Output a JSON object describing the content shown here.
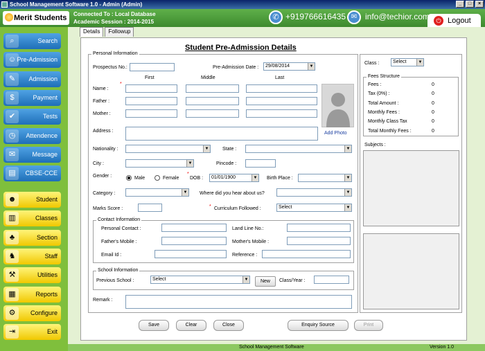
{
  "window": {
    "title": "School Management Software 1.0 -  Admin (Admin)"
  },
  "header": {
    "app_name": "Merit Students",
    "connection": "Connected To : Local Database",
    "session": "Academic Session : 2014-2015",
    "phone": "+919766616435",
    "email": "info@techior.com",
    "logout_label": "Logout"
  },
  "sidebar": {
    "blue_items": [
      {
        "label": "Search",
        "icon": "magnifier-icon"
      },
      {
        "label": "Pre-Admission",
        "icon": "person-icon"
      },
      {
        "label": "Admission",
        "icon": "pencil-icon"
      },
      {
        "label": "Payment",
        "icon": "cash-icon"
      },
      {
        "label": "Tests",
        "icon": "checklist-icon"
      },
      {
        "label": "Attendence",
        "icon": "clock-icon"
      },
      {
        "label": "Message",
        "icon": "envelope-icon"
      },
      {
        "label": "CBSE-CCE",
        "icon": "book-icon"
      }
    ],
    "yellow_items": [
      {
        "label": "Student",
        "icon": "students-icon"
      },
      {
        "label": "Classes",
        "icon": "document-icon"
      },
      {
        "label": "Section",
        "icon": "group-icon"
      },
      {
        "label": "Staff",
        "icon": "staff-icon"
      },
      {
        "label": "Utilities",
        "icon": "tools-icon"
      },
      {
        "label": "Reports",
        "icon": "report-icon"
      },
      {
        "label": "Configure",
        "icon": "gear-icon"
      },
      {
        "label": "Exit",
        "icon": "exit-icon"
      }
    ]
  },
  "tabs": [
    "Details",
    "Followup"
  ],
  "form": {
    "title": "Student Pre-Admission Details",
    "personal_legend": "Personal Information",
    "prospectus_label": "Prospectus No.:",
    "prospectus_value": "",
    "pre_date_label": "Pre-Admission Date :",
    "pre_date_value": "29/08/2014",
    "col_first": "First",
    "col_middle": "Middle",
    "col_last": "Last",
    "name_label": "Name :",
    "father_label": "Father :",
    "mother_label": "Mother :",
    "address_label": "Address :",
    "add_photo": "Add Photo",
    "nationality_label": "Nationality :",
    "state_label": "State :",
    "city_label": "City :",
    "pincode_label": "Pincode :",
    "gender_label": "Gender :",
    "male": "Male",
    "female": "Female",
    "dob_label": "DOB :",
    "dob_value": "01/01/1900",
    "birth_place_label": "Birth Place :",
    "category_label": "Category :",
    "hear_label": "Where did you hear about us?",
    "marks_label": "Marks Score :",
    "curriculum_label": "Curriculum Followed :",
    "curriculum_value": "Select",
    "contact_legend": "Contact Information",
    "personal_contact_label": "Personal Contact :",
    "landline_label": "Land Line No.:",
    "father_mobile_label": "Father's Mobile :",
    "mother_mobile_label": "Mother's Mobile :",
    "email_label": "Email Id :",
    "reference_label": "Reference :",
    "school_legend": "School Information",
    "previous_school_label": "Previous School :",
    "previous_school_value": "Select",
    "new_button": "New",
    "class_year_label": "Class/Year :",
    "remark_label": "Remark :"
  },
  "right_panel": {
    "class_label": "Class :",
    "class_value": "Select",
    "fees_legend": "Fees Structure",
    "fees_rows": [
      {
        "label": "Fees :",
        "value": "0"
      },
      {
        "label": "Tax (0%) :",
        "value": "0"
      },
      {
        "label": "Total Amount :",
        "value": "0"
      },
      {
        "label": "Monthly Fees :",
        "value": "0"
      },
      {
        "label": "Monthly Class Tax",
        "value": "0"
      },
      {
        "label": "Total Monthly Fees :",
        "value": "0"
      }
    ],
    "subjects_label": "Subjects :"
  },
  "buttons": {
    "save": "Save",
    "clear": "Clear",
    "close": "Close",
    "enquiry": "Enquiry Source",
    "print": "Print"
  },
  "status": {
    "center": "School Management Software",
    "version": "Version 1.0"
  }
}
